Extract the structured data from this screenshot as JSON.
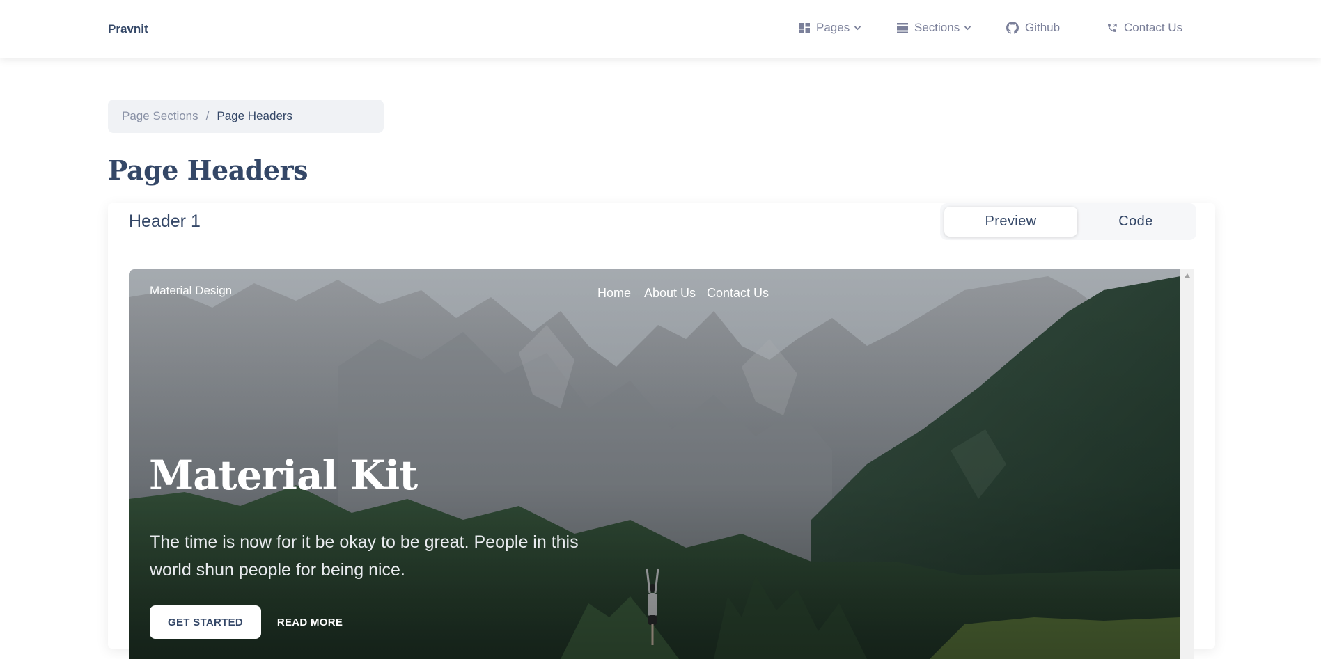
{
  "navbar": {
    "brand": "Pravnit",
    "items": [
      {
        "label": "Pages",
        "icon": "dashboard-icon",
        "dropdown": true
      },
      {
        "label": "Sections",
        "icon": "view-day-icon",
        "dropdown": true
      },
      {
        "label": "Github",
        "icon": "github-icon",
        "dropdown": false
      },
      {
        "label": "Contact Us",
        "icon": "phone-icon",
        "dropdown": false
      }
    ]
  },
  "breadcrumb": {
    "parent": "Page Sections",
    "separator": "/",
    "current": "Page Headers"
  },
  "page": {
    "title": "Page Headers"
  },
  "card": {
    "title": "Header 1",
    "tabs": {
      "preview": "Preview",
      "code": "Code",
      "active": "Preview"
    }
  },
  "preview": {
    "brand": "Material Design",
    "nav": [
      "Home",
      "About Us",
      "Contact Us"
    ],
    "title": "Material Kit",
    "text": "The time is now for it be okay to be great. People in this world shun people for being nice.",
    "primary_button": "GET STARTED",
    "secondary_button": "READ MORE"
  },
  "colors": {
    "text_dark": "#344767",
    "text_muted": "#7b809a",
    "breadcrumb_bg": "#f0f2f5",
    "white": "#ffffff"
  }
}
